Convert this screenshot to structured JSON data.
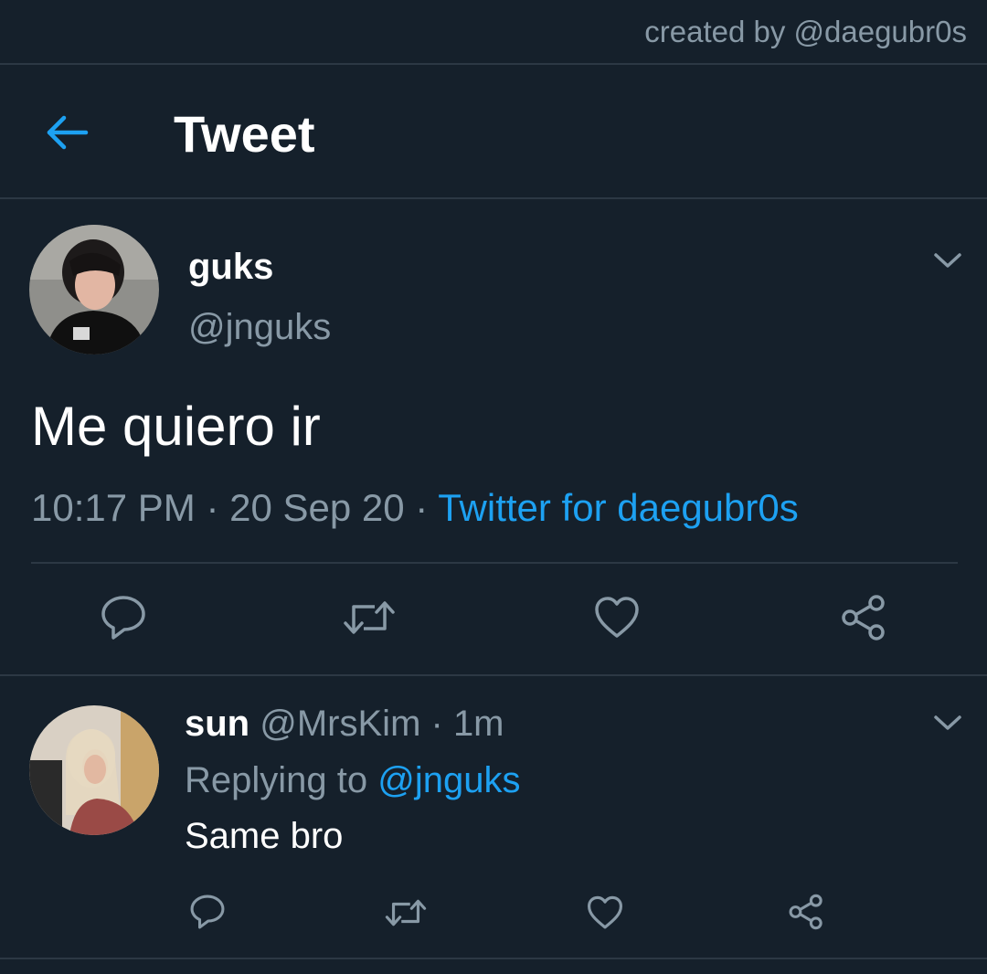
{
  "watermark": "created by @daegubr0s",
  "header": {
    "back_icon": "arrow-left-icon",
    "title": "Tweet"
  },
  "tweet": {
    "author_name": "guks",
    "author_handle": "@jnguks",
    "text": "Me quiero ir",
    "time": "10:17 PM",
    "date": "20 Sep 20",
    "separator": " · ",
    "source": "Twitter for daegubr0s",
    "actions": [
      "reply-icon",
      "retweet-icon",
      "like-icon",
      "share-icon"
    ]
  },
  "reply": {
    "author_name": "sun",
    "author_handle": "@MrsKim",
    "separator": " · ",
    "time": "1m",
    "replying_prefix": "Replying to ",
    "replying_to": "@jnguks",
    "text": "Same bro",
    "actions": [
      "reply-icon",
      "retweet-icon",
      "like-icon",
      "share-icon"
    ]
  },
  "colors": {
    "background": "#15202b",
    "accent": "#1da1f2",
    "secondary_text": "#8899a6",
    "divider": "#2c3844"
  }
}
